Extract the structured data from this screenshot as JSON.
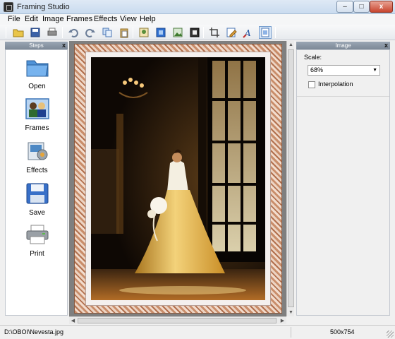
{
  "window": {
    "title": "Framing Studio",
    "buttons": {
      "minimize": "–",
      "maximize": "□",
      "close": "x"
    }
  },
  "menu": [
    "File",
    "Edit",
    "Image",
    "Frames",
    "Effects",
    "View",
    "Help"
  ],
  "toolbar": {
    "icons": [
      "open-folder-icon",
      "save-icon",
      "print-icon",
      "undo-icon",
      "redo-icon",
      "copy-icon",
      "paste-icon",
      "image-icon",
      "frame-icon",
      "picture-icon",
      "border-icon",
      "crop-icon",
      "edit-icon",
      "text-icon",
      "fit-icon"
    ]
  },
  "steps_panel": {
    "title": "Steps",
    "close": "x",
    "items": [
      {
        "label": "Open",
        "icon": "folder-icon"
      },
      {
        "label": "Frames",
        "icon": "frames-icon"
      },
      {
        "label": "Effects",
        "icon": "effects-icon"
      },
      {
        "label": "Save",
        "icon": "floppy-icon"
      },
      {
        "label": "Print",
        "icon": "printer-icon"
      }
    ]
  },
  "image_panel": {
    "title": "Image",
    "close": "x",
    "scale_label": "Scale:",
    "scale_value": "68%",
    "interpolation_label": "Interpolation",
    "interpolation_checked": false
  },
  "status": {
    "path": "D:\\OBOI\\Nevesta.jpg",
    "size": "500x754"
  },
  "colors": {
    "titlebar": "#c9dbef",
    "frame_wood": "#c98d6a",
    "panel_header": "#7c8896"
  }
}
